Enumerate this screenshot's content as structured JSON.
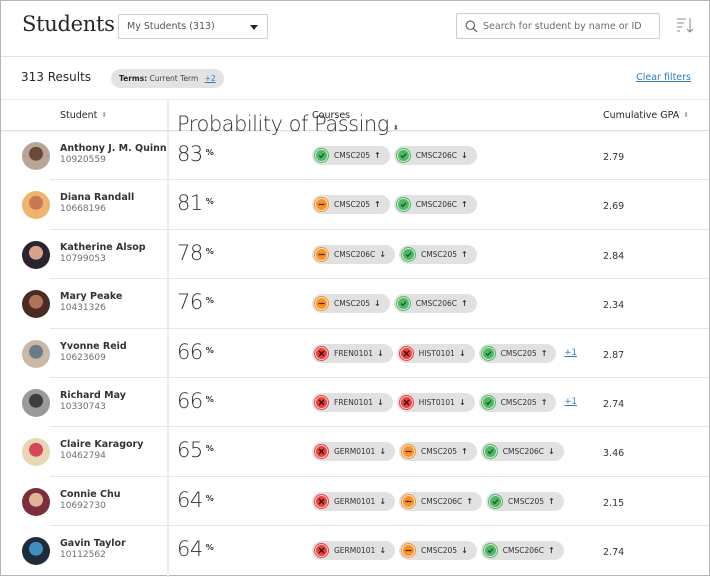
{
  "header": {
    "title": "Students",
    "view_select": "My Students (313)",
    "search_placeholder": "Search for student by name or ID",
    "sort_icon": "sort-descending-icon"
  },
  "filters": {
    "results": "313 Results",
    "term_label": "Terms:",
    "term_value": "Current Term",
    "term_more": "+2",
    "clear": "Clear filters"
  },
  "columns": {
    "student": "Student",
    "probability": "Probability of Passing",
    "courses": "Courses",
    "gpa": "Cumulative GPA"
  },
  "colors": {
    "pass": "#4fb763",
    "warn": "#f7932a",
    "fail": "#e8403b",
    "link": "#2b7dbc",
    "chip_bg": "#e1e1e1"
  },
  "students": [
    {
      "name": "Anthony J. M. Quinn",
      "id": "10920559",
      "probability": "83",
      "gpa": "2.79",
      "avatar": [
        "#b8a595",
        "#6b4a3a"
      ],
      "courses": [
        {
          "code": "CMSC205",
          "status": "pass",
          "trend": "up"
        },
        {
          "code": "CMSC206C",
          "status": "pass",
          "trend": "down"
        }
      ],
      "more": ""
    },
    {
      "name": "Diana Randall",
      "id": "10668196",
      "probability": "81",
      "gpa": "2.69",
      "avatar": [
        "#f0b26c",
        "#c77a52"
      ],
      "courses": [
        {
          "code": "CMSC205",
          "status": "warn",
          "trend": "up"
        },
        {
          "code": "CMSC206C",
          "status": "pass",
          "trend": "up"
        }
      ],
      "more": ""
    },
    {
      "name": "Katherine Alsop",
      "id": "10799053",
      "probability": "78",
      "gpa": "2.84",
      "avatar": [
        "#2a2330",
        "#d9a08a"
      ],
      "courses": [
        {
          "code": "CMSC206C",
          "status": "warn",
          "trend": "down"
        },
        {
          "code": "CMSC205",
          "status": "pass",
          "trend": "up"
        }
      ],
      "more": ""
    },
    {
      "name": "Mary Peake",
      "id": "10431326",
      "probability": "76",
      "gpa": "2.34",
      "avatar": [
        "#4a2a22",
        "#b07258"
      ],
      "courses": [
        {
          "code": "CMSC205",
          "status": "warn",
          "trend": "down"
        },
        {
          "code": "CMSC206C",
          "status": "pass",
          "trend": "up"
        }
      ],
      "more": ""
    },
    {
      "name": "Yvonne Reid",
      "id": "10623609",
      "probability": "66",
      "gpa": "2.87",
      "avatar": [
        "#c9b9a5",
        "#6a7c8c"
      ],
      "courses": [
        {
          "code": "FREN0101",
          "status": "fail",
          "trend": "down"
        },
        {
          "code": "HIST0101",
          "status": "fail",
          "trend": "down"
        },
        {
          "code": "CMSC205",
          "status": "pass",
          "trend": "up"
        }
      ],
      "more": "+1"
    },
    {
      "name": "Richard May",
      "id": "10330743",
      "probability": "66",
      "gpa": "2.74",
      "avatar": [
        "#9a9a9a",
        "#3d3d3d"
      ],
      "courses": [
        {
          "code": "FREN0101",
          "status": "fail",
          "trend": "down"
        },
        {
          "code": "HIST0101",
          "status": "fail",
          "trend": "down"
        },
        {
          "code": "CMSC205",
          "status": "pass",
          "trend": "up"
        }
      ],
      "more": "+1"
    },
    {
      "name": "Claire Karagory",
      "id": "10462794",
      "probability": "65",
      "gpa": "3.46",
      "avatar": [
        "#e8d6b5",
        "#d8465a"
      ],
      "courses": [
        {
          "code": "GERM0101",
          "status": "fail",
          "trend": "down"
        },
        {
          "code": "CMSC205",
          "status": "warn",
          "trend": "up"
        },
        {
          "code": "CMSC206C",
          "status": "pass",
          "trend": "down"
        }
      ],
      "more": ""
    },
    {
      "name": "Connie Chu",
      "id": "10692730",
      "probability": "64",
      "gpa": "2.15",
      "avatar": [
        "#7a2f3b",
        "#e0b49a"
      ],
      "courses": [
        {
          "code": "GERM0101",
          "status": "fail",
          "trend": "down"
        },
        {
          "code": "CMSC206C",
          "status": "warn",
          "trend": "up"
        },
        {
          "code": "CMSC205",
          "status": "pass",
          "trend": "up"
        }
      ],
      "more": ""
    },
    {
      "name": "Gavin Taylor",
      "id": "10112562",
      "probability": "64",
      "gpa": "2.74",
      "avatar": [
        "#1f2a3a",
        "#3d8fc0"
      ],
      "courses": [
        {
          "code": "GERM0101",
          "status": "fail",
          "trend": "down"
        },
        {
          "code": "CMSC205",
          "status": "warn",
          "trend": "down"
        },
        {
          "code": "CMSC206C",
          "status": "pass",
          "trend": "up"
        }
      ],
      "more": ""
    }
  ]
}
